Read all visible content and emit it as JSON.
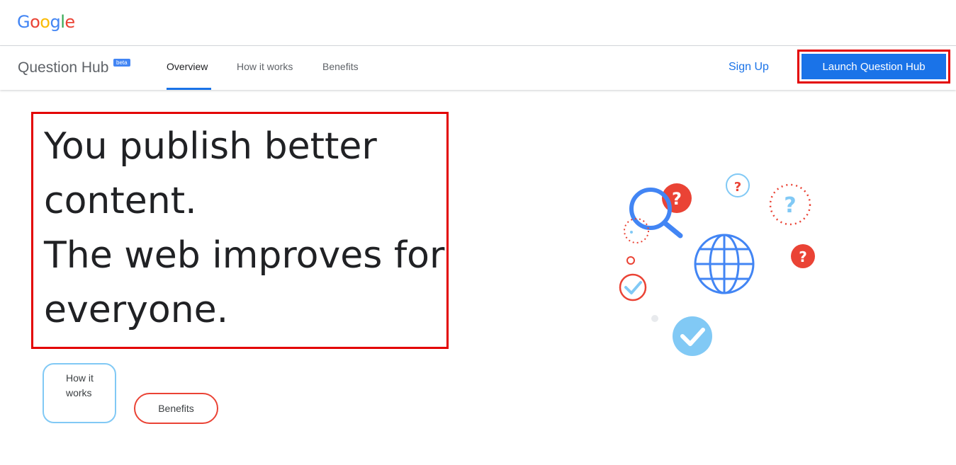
{
  "header": {
    "logo_letters": [
      "G",
      "o",
      "o",
      "g",
      "l",
      "e"
    ],
    "logo_colors": [
      "#4285F4",
      "#EA4335",
      "#FBBC05",
      "#4285F4",
      "#34A853",
      "#EA4335"
    ]
  },
  "nav": {
    "product_name": "Question Hub",
    "beta_badge": "beta",
    "tabs": [
      {
        "label": "Overview",
        "active": true
      },
      {
        "label": "How it works",
        "active": false
      },
      {
        "label": "Benefits",
        "active": false
      }
    ],
    "sign_up": "Sign Up",
    "launch_button": "Launch Question Hub"
  },
  "hero": {
    "headline_lines": [
      "You publish better",
      "content.",
      "The web improves for",
      "everyone."
    ],
    "buttons": {
      "how_it_works": "How it works",
      "benefits": "Benefits"
    }
  },
  "illustration": {
    "question_mark": "?",
    "icons": [
      "magnifier-icon",
      "globe-icon",
      "question-bubble-icon",
      "check-icon"
    ]
  },
  "colors": {
    "primary": "#1a73e8",
    "highlight_border": "#e30000",
    "red": "#ea4335",
    "light_blue": "#81c9f5"
  }
}
